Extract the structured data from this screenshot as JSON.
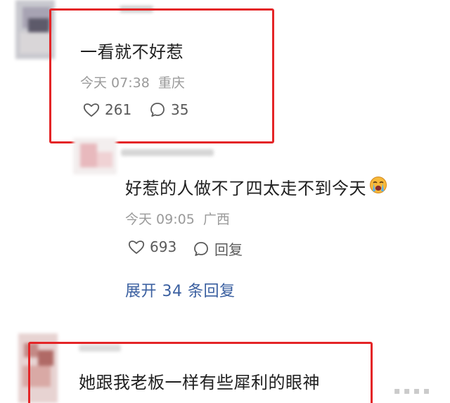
{
  "comments": [
    {
      "text": "一看就不好惹",
      "time": "今天 07:38",
      "location": "重庆",
      "likes": "261",
      "replies": "35"
    },
    {
      "text": "好惹的人做不了四太走不到今天",
      "emoji_icon": "crying-face-emoji",
      "time": "今天 09:05",
      "location": "广西",
      "likes": "693",
      "reply_label": "回复",
      "expand_label": "展开 34 条回复"
    },
    {
      "text": "她跟我老板一样有些犀利的眼神"
    }
  ],
  "highlight_color": "#e42527",
  "link_color": "#3a5fa0",
  "meta_color": "#9a9a9a",
  "icons": [
    "heart-icon",
    "comment-bubble-icon",
    "crying-face-emoji"
  ]
}
